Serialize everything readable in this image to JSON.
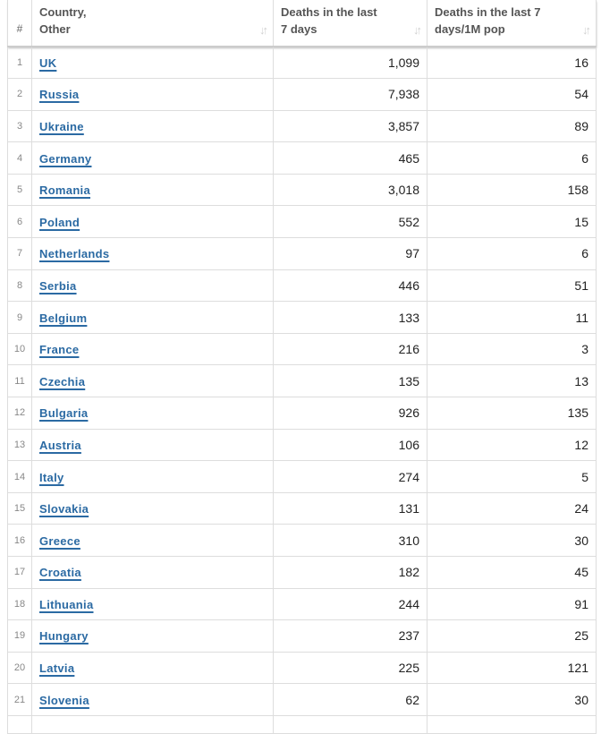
{
  "table": {
    "headers": {
      "num": "#",
      "country": "Country, Other",
      "country_line1": "Country,",
      "country_line2": "Other",
      "deaths_7d_line1": "Deaths in the last",
      "deaths_7d_line2": "7 days",
      "deaths_7d_pm_line1": "Deaths in the last 7",
      "deaths_7d_pm_line2": "days/1M pop"
    },
    "sort_icon": "sort-icon",
    "rows": [
      {
        "num": "1",
        "country": "UK",
        "deaths_7d": "1,099",
        "deaths_7d_per_1m": "16"
      },
      {
        "num": "2",
        "country": "Russia",
        "deaths_7d": "7,938",
        "deaths_7d_per_1m": "54"
      },
      {
        "num": "3",
        "country": "Ukraine",
        "deaths_7d": "3,857",
        "deaths_7d_per_1m": "89"
      },
      {
        "num": "4",
        "country": "Germany",
        "deaths_7d": "465",
        "deaths_7d_per_1m": "6"
      },
      {
        "num": "5",
        "country": "Romania",
        "deaths_7d": "3,018",
        "deaths_7d_per_1m": "158"
      },
      {
        "num": "6",
        "country": "Poland",
        "deaths_7d": "552",
        "deaths_7d_per_1m": "15"
      },
      {
        "num": "7",
        "country": "Netherlands",
        "deaths_7d": "97",
        "deaths_7d_per_1m": "6"
      },
      {
        "num": "8",
        "country": "Serbia",
        "deaths_7d": "446",
        "deaths_7d_per_1m": "51"
      },
      {
        "num": "9",
        "country": "Belgium",
        "deaths_7d": "133",
        "deaths_7d_per_1m": "11"
      },
      {
        "num": "10",
        "country": "France",
        "deaths_7d": "216",
        "deaths_7d_per_1m": "3"
      },
      {
        "num": "11",
        "country": "Czechia",
        "deaths_7d": "135",
        "deaths_7d_per_1m": "13"
      },
      {
        "num": "12",
        "country": "Bulgaria",
        "deaths_7d": "926",
        "deaths_7d_per_1m": "135"
      },
      {
        "num": "13",
        "country": "Austria",
        "deaths_7d": "106",
        "deaths_7d_per_1m": "12"
      },
      {
        "num": "14",
        "country": "Italy",
        "deaths_7d": "274",
        "deaths_7d_per_1m": "5"
      },
      {
        "num": "15",
        "country": "Slovakia",
        "deaths_7d": "131",
        "deaths_7d_per_1m": "24"
      },
      {
        "num": "16",
        "country": "Greece",
        "deaths_7d": "310",
        "deaths_7d_per_1m": "30"
      },
      {
        "num": "17",
        "country": "Croatia",
        "deaths_7d": "182",
        "deaths_7d_per_1m": "45"
      },
      {
        "num": "18",
        "country": "Lithuania",
        "deaths_7d": "244",
        "deaths_7d_per_1m": "91"
      },
      {
        "num": "19",
        "country": "Hungary",
        "deaths_7d": "237",
        "deaths_7d_per_1m": "25"
      },
      {
        "num": "20",
        "country": "Latvia",
        "deaths_7d": "225",
        "deaths_7d_per_1m": "121"
      },
      {
        "num": "21",
        "country": "Slovenia",
        "deaths_7d": "62",
        "deaths_7d_per_1m": "30"
      }
    ]
  },
  "colors": {
    "link": "#2b6aa3",
    "border": "#dddddd",
    "header_text": "#555555",
    "sort_icon": "#d0d0d0"
  }
}
